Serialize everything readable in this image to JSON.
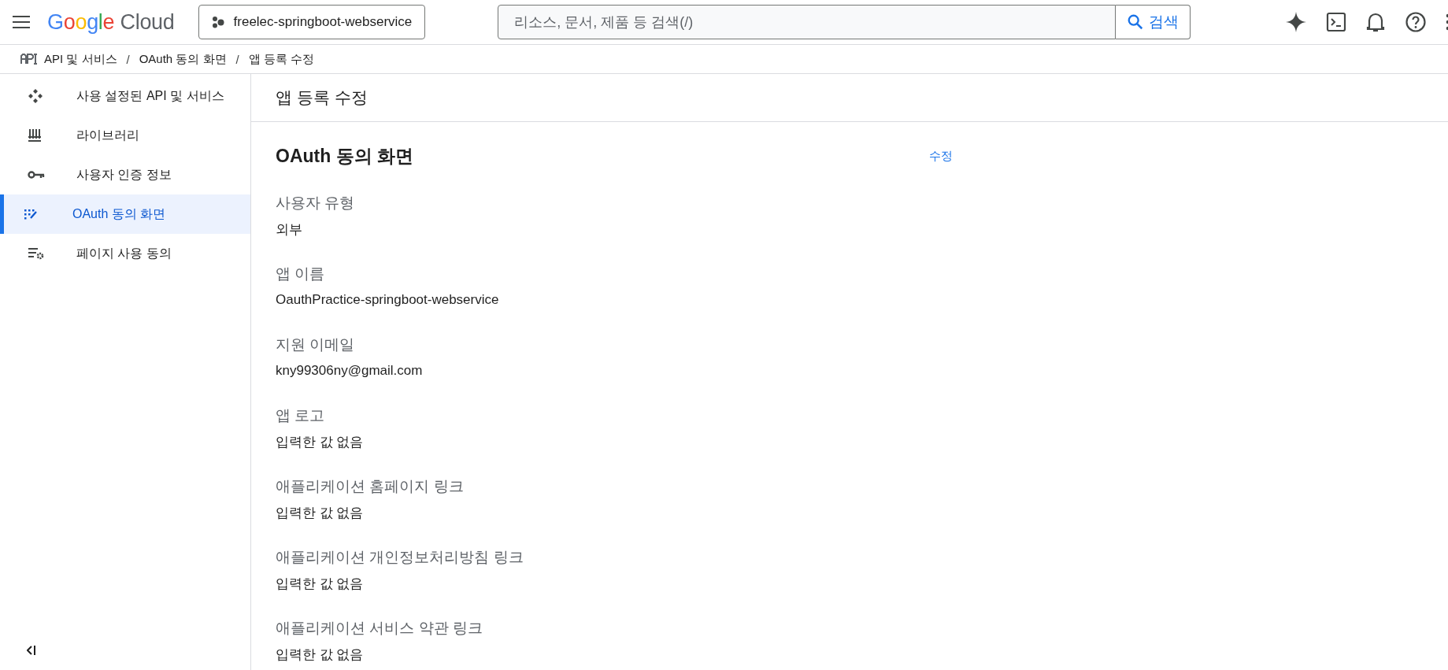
{
  "topbar": {
    "logo": "Google Cloud",
    "project": "freelec-springboot-webservice",
    "search": {
      "placeholder": "리소스, 문서, 제품 등 검색(/)"
    },
    "search_button": "검색"
  },
  "breadcrumb_separator": "/",
  "breadcrumb": [
    {
      "label": "API 및 서비스",
      "kind": "api"
    },
    {
      "label": "OAuth 동의 화면",
      "kind": "link"
    },
    {
      "label": "앱 등록 수정",
      "kind": "current"
    }
  ],
  "sidebar": {
    "items": [
      {
        "label": "사용 설정된 API 및 서비스",
        "selected": false
      },
      {
        "label": "라이브러리",
        "selected": false
      },
      {
        "label": "사용자 인증 정보",
        "selected": false
      },
      {
        "label": "OAuth 동의 화면",
        "selected": true
      },
      {
        "label": "페이지 사용 동의",
        "selected": false
      }
    ]
  },
  "page_title": "앱 등록 수정",
  "section": {
    "title": "OAuth 동의 화면",
    "edit_link": "수정",
    "fields": [
      {
        "label": "사용자 유형",
        "value": "외부"
      },
      {
        "label": "앱 이름",
        "value": "OauthPractice-springboot-webservice"
      },
      {
        "label": "지원 이메일",
        "value": "kny99306ny@gmail.com"
      },
      {
        "label": "앱 로고",
        "value": "입력한 값 없음"
      },
      {
        "label": "애플리케이션 홈페이지 링크",
        "value": "입력한 값 없음"
      },
      {
        "label": "애플리케이션 개인정보처리방침 링크",
        "value": "입력한 값 없음"
      },
      {
        "label": "애플리케이션 서비스 약관 링크",
        "value": "입력한 값 없음"
      }
    ]
  }
}
